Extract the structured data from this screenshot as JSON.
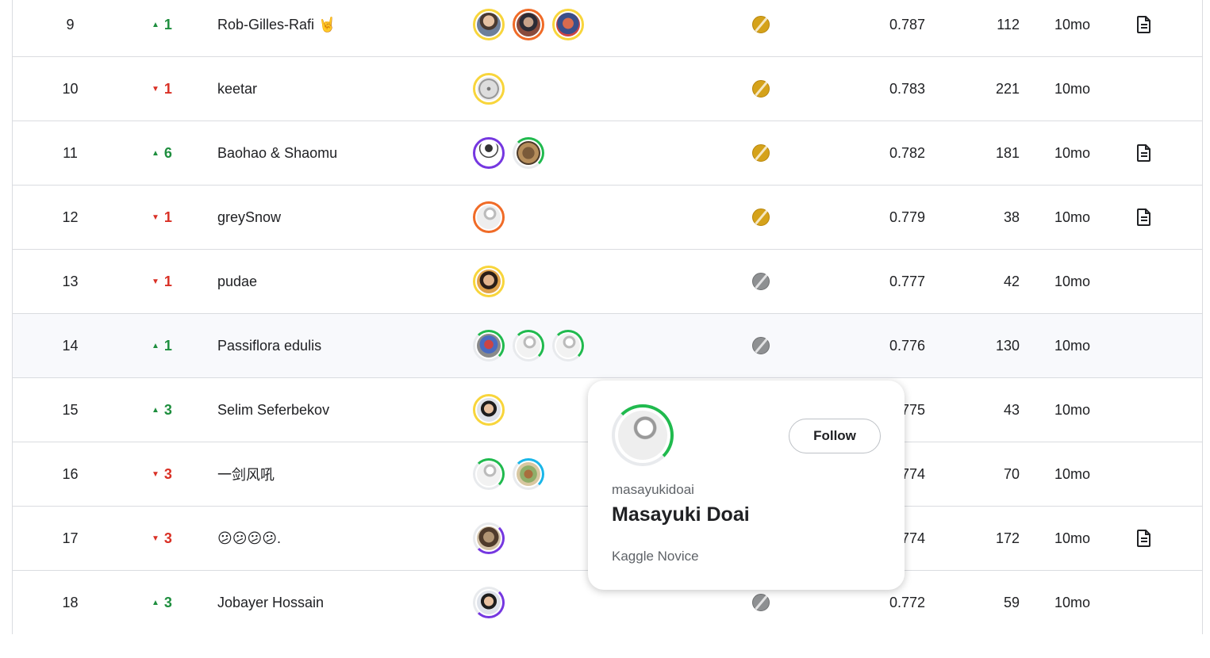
{
  "rows": [
    {
      "rank": "9",
      "delta": "1",
      "dir": "up",
      "team": "Rob-Gilles-Rafi 🤘",
      "members": [
        {
          "ring": "ring-yellow",
          "face": "person"
        },
        {
          "ring": "ring-orange",
          "face": "dark"
        },
        {
          "ring": "ring-yellow",
          "face": "red"
        }
      ],
      "medal": "gold",
      "score": "0.787",
      "entries": "112",
      "last": "10mo",
      "code": true
    },
    {
      "rank": "10",
      "delta": "1",
      "dir": "down",
      "team": "keetar",
      "members": [
        {
          "ring": "ring-yellow",
          "face": "fan"
        }
      ],
      "medal": "gold",
      "score": "0.783",
      "entries": "221",
      "last": "10mo",
      "code": false
    },
    {
      "rank": "11",
      "delta": "6",
      "dir": "up",
      "team": "Baohao & Shaomu",
      "members": [
        {
          "ring": "ring-purple",
          "face": "robot"
        },
        {
          "ring": "ring-green-partial",
          "face": "cat"
        }
      ],
      "medal": "gold",
      "score": "0.782",
      "entries": "181",
      "last": "10mo",
      "code": true
    },
    {
      "rank": "12",
      "delta": "1",
      "dir": "down",
      "team": "greySnow",
      "members": [
        {
          "ring": "ring-orange",
          "face": "goose"
        }
      ],
      "medal": "gold",
      "score": "0.779",
      "entries": "38",
      "last": "10mo",
      "code": true
    },
    {
      "rank": "13",
      "delta": "1",
      "dir": "down",
      "team": "pudae",
      "members": [
        {
          "ring": "ring-yellow",
          "face": "asian"
        }
      ],
      "medal": "silver",
      "score": "0.777",
      "entries": "42",
      "last": "10mo",
      "code": false
    },
    {
      "rank": "14",
      "delta": "1",
      "dir": "up",
      "team": "Passiflora edulis",
      "members": [
        {
          "ring": "ring-green-partial",
          "face": "runner"
        },
        {
          "ring": "ring-green-partial",
          "face": "goose2"
        },
        {
          "ring": "ring-green-partial",
          "face": "goose2"
        }
      ],
      "medal": "silver",
      "score": "0.776",
      "entries": "130",
      "last": "10mo",
      "code": false,
      "highlight": true
    },
    {
      "rank": "15",
      "delta": "3",
      "dir": "up",
      "team": "Selim Seferbekov",
      "members": [
        {
          "ring": "ring-yellow",
          "face": "glasses"
        }
      ],
      "medal": "silver",
      "score": "0.775",
      "entries": "43",
      "last": "10mo",
      "code": false
    },
    {
      "rank": "16",
      "delta": "3",
      "dir": "down",
      "team": "一剑风吼",
      "members": [
        {
          "ring": "ring-green-partial",
          "face": "goose2"
        },
        {
          "ring": "ring-blue-partial",
          "face": "bamboo"
        }
      ],
      "medal": "silver",
      "score": "0.774",
      "entries": "70",
      "last": "10mo",
      "code": false
    },
    {
      "rank": "17",
      "delta": "3",
      "dir": "down",
      "team": "😕😕😕😕.",
      "members": [
        {
          "ring": "ring-purple-partial",
          "face": "sketch"
        }
      ],
      "medal": "silver",
      "score": "0.774",
      "entries": "172",
      "last": "10mo",
      "code": true
    },
    {
      "rank": "18",
      "delta": "3",
      "dir": "up",
      "team": "Jobayer Hossain",
      "members": [
        {
          "ring": "ring-purple-partial",
          "face": "glasses"
        }
      ],
      "medal": "silver",
      "score": "0.772",
      "entries": "59",
      "last": "10mo",
      "code": false
    }
  ],
  "card": {
    "username": "masayukidoai",
    "fullname": "Masayuki Doai",
    "tier": "Kaggle Novice",
    "follow_label": "Follow"
  },
  "colors": {
    "up": "#1e8e3e",
    "down": "#d93025",
    "gold": "#d5a21a",
    "silver": "#8e9092"
  },
  "icons": {
    "up": "caret-up-icon",
    "down": "caret-down-icon",
    "code": "notebook-document-icon",
    "medal": "medal-icon"
  }
}
